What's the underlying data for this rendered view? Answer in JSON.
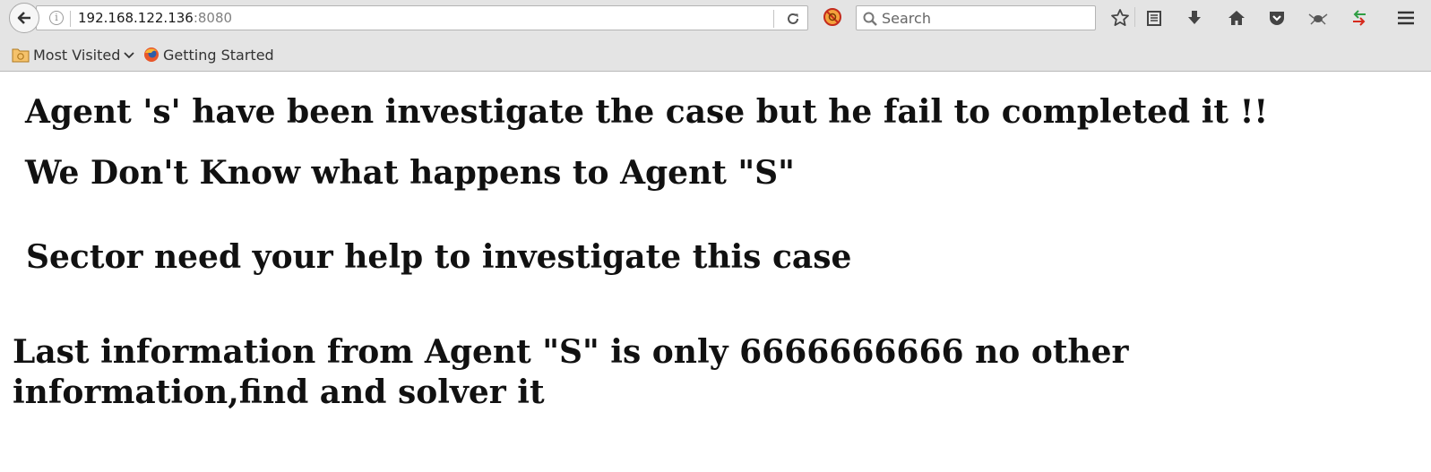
{
  "browser": {
    "url_host": "192.168.122.136",
    "url_port": ":8080",
    "search_placeholder": "Search",
    "bookmarks": [
      {
        "label": "Most Visited",
        "icon": "folder-icon"
      },
      {
        "label": "Getting Started",
        "icon": "firefox-icon"
      }
    ],
    "toolbar_icons": [
      "star-icon",
      "reading-list-icon",
      "download-icon",
      "home-icon",
      "pocket-icon",
      "extension-icon",
      "sync-arrows-icon",
      "menu-icon"
    ]
  },
  "page": {
    "line1": "Agent 's' have been investigate the case but he fail to completed it !!",
    "line2": "We Don't Know what happens to Agent \"S\"",
    "line3": "Sector need your help to investigate this case",
    "line4": "Last information from Agent \"S\" is only 6666666666 no other information,find and solver it"
  }
}
